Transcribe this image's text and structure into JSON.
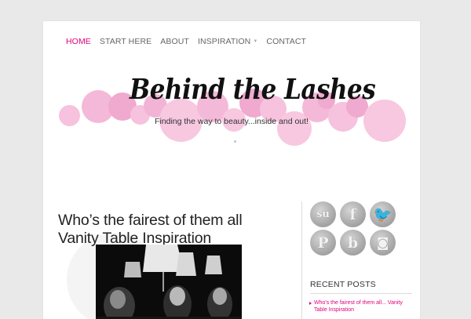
{
  "nav": {
    "items": [
      {
        "label": "HOME",
        "active": true
      },
      {
        "label": "START HERE"
      },
      {
        "label": "ABOUT"
      },
      {
        "label": "INSPIRATION",
        "has_dropdown": true
      },
      {
        "label": "CONTACT"
      }
    ]
  },
  "header": {
    "site_title": "Behind the Lashes",
    "tagline": "Finding the way to beauty...inside and out!"
  },
  "post": {
    "title_line1": "Who’s the fairest of them all",
    "title_line2": "Vanity Table Inspiration"
  },
  "sidebar": {
    "social": [
      {
        "icon": "stumbleupon-icon",
        "glyph": "su"
      },
      {
        "icon": "facebook-icon",
        "glyph": "f"
      },
      {
        "icon": "twitter-icon",
        "glyph": "t"
      },
      {
        "icon": "pinterest-icon",
        "glyph": "P"
      },
      {
        "icon": "bloglovin-icon",
        "glyph": "b"
      },
      {
        "icon": "instagram-icon",
        "glyph": "◙"
      }
    ],
    "recent_posts_title": "RECENT POSTS",
    "recent_posts": [
      {
        "label": "Who's the fairest of them all... Vanity Table Inspiration"
      }
    ]
  },
  "colors": {
    "accent": "#e0007a",
    "bubble_pink": "#f6c2dd",
    "bubble_pink_dark": "#f0a9cf",
    "page_bg": "#e9e9e9"
  }
}
